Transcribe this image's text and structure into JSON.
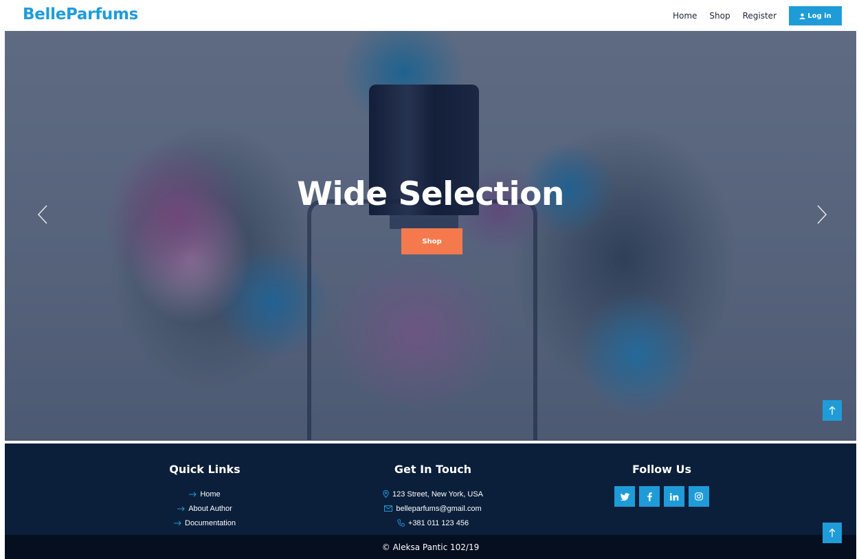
{
  "navbar": {
    "brand": "BelleParfums",
    "links": [
      "Home",
      "Shop",
      "Register"
    ],
    "login_label": "Log in"
  },
  "hero": {
    "title": "Wide Selection",
    "button_label": "Shop"
  },
  "footer": {
    "quick_links": {
      "heading": "Quick Links",
      "items": [
        "Home",
        "About Author",
        "Documentation"
      ]
    },
    "get_in_touch": {
      "heading": "Get In Touch",
      "address": "123 Street, New York, USA",
      "email": "belleparfums@gmail.com",
      "phone": "+381 011 123 456"
    },
    "follow_us": {
      "heading": "Follow Us",
      "social": [
        "twitter-icon",
        "facebook-icon",
        "linkedin-icon",
        "instagram-icon"
      ]
    },
    "copyright": "© Aleksa Pantic 102/19"
  },
  "colors": {
    "accent": "#1f9cd8",
    "cta": "#f47a4e",
    "footer_bg": "#0b1f3b",
    "copyright_bg": "#060f1f"
  }
}
